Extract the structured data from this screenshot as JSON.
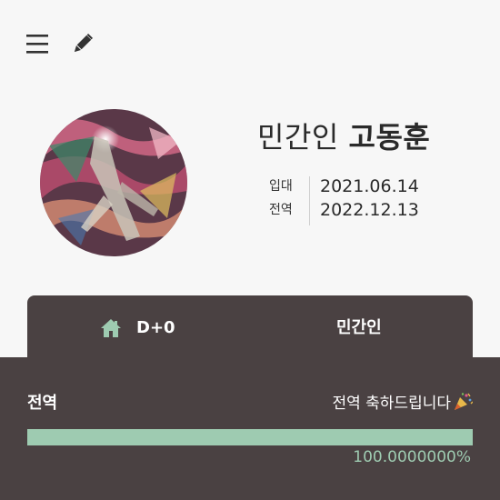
{
  "header": {
    "menu_icon": "hamburger-menu-icon",
    "edit_icon": "pencil-icon"
  },
  "profile": {
    "rank": "민간인",
    "name": "고동훈",
    "enlist_label": "입대",
    "enlist_date": "2021.06.14",
    "discharge_label": "전역",
    "discharge_date": "2022.12.13"
  },
  "status_card": {
    "home_icon": "home-icon",
    "dday": "D+0",
    "rank_label": "민간인"
  },
  "progress": {
    "title": "전역",
    "message": "전역 축하드립니다",
    "message_icon": "party-popper-icon",
    "percent_text": "100.0000000%",
    "value": 1.0
  },
  "colors": {
    "background": "#f7f7f7",
    "card": "#4a4142",
    "accent": "#9ecbb1"
  }
}
